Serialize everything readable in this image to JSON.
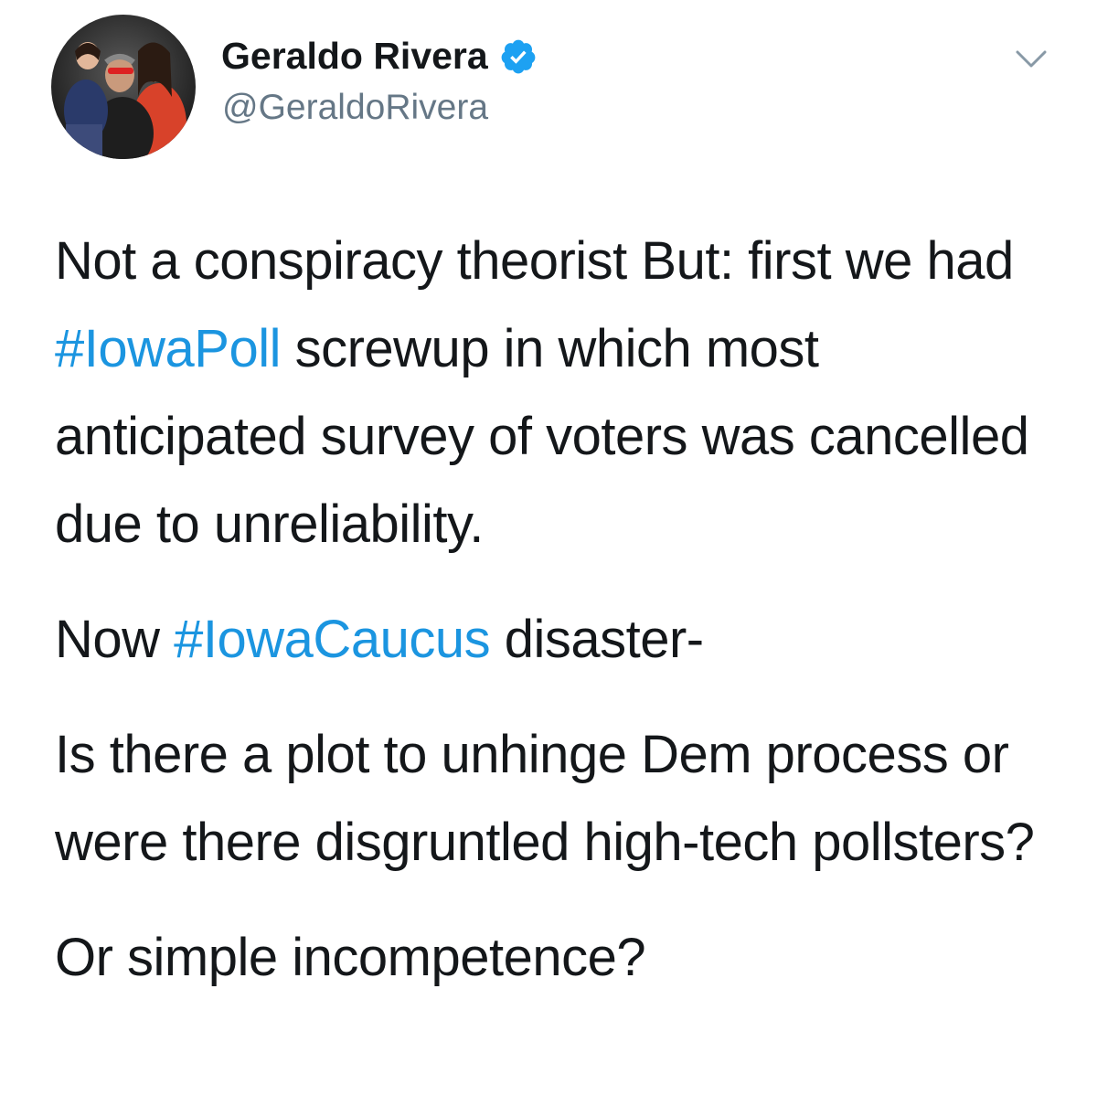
{
  "header": {
    "display_name": "Geraldo Rivera",
    "handle": "@GeraldoRivera",
    "verified_icon": "verified-badge-icon",
    "menu_icon": "chevron-down-icon",
    "accent_color": "#1b95e0"
  },
  "tweet": {
    "p1_a": "Not a conspiracy theorist But: first we had ",
    "p1_hashtag": "#IowaPoll",
    "p1_b": " screwup in which most anticipated survey of voters was cancelled due to unreliability.",
    "p2_a": "Now ",
    "p2_hashtag": "#IowaCaucus",
    "p2_b": " disaster-",
    "p3": "Is there a plot to unhinge Dem process or were there disgruntled high-tech pollsters?",
    "p4": "Or simple incompetence?"
  }
}
